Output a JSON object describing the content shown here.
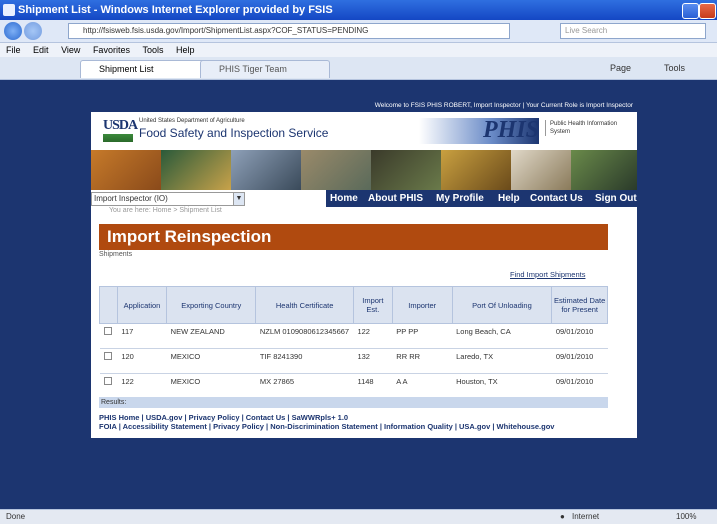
{
  "window": {
    "title": "Shipment List - Windows Internet Explorer provided by FSIS"
  },
  "address": {
    "url": "http://fsisweb.fsis.usda.gov/Import/ShipmentList.aspx?COF_STATUS=PENDING",
    "search_placeholder": "Live Search"
  },
  "menu": [
    "File",
    "Edit",
    "View",
    "Favorites",
    "Tools",
    "Help"
  ],
  "tabs": [
    {
      "label": "Shipment List"
    },
    {
      "label": "PHIS Tiger Team"
    }
  ],
  "toolbar": {
    "page_label": "Page",
    "tools_label": "Tools"
  },
  "site": {
    "welcome": "Welcome to FSIS PHIS ROBERT, Import Inspector | Your Current Role is Import Inspector",
    "agency_dept": "United States Department of Agriculture",
    "agency_name": "Food Safety and Inspection Service",
    "usda": "USDA",
    "phis": "PHIS",
    "phis_full": "Public Health Information System",
    "role_select": "Import Inspector (IO)",
    "nav": [
      "Home",
      "About PHIS",
      "My Profile",
      "Help",
      "Contact Us",
      "Sign Out"
    ],
    "breadcrumb": "You are here: Home > Shipment List"
  },
  "content": {
    "title": "Import Reinspection",
    "subtitle": "Shipments",
    "find_link": "Find Import Shipments",
    "columns": [
      "Application",
      "Exporting Country",
      "Health Certificate",
      "Import Est.",
      "Importer",
      "Port Of Unloading",
      "Estimated Date for Present"
    ],
    "rows": [
      {
        "application": "117",
        "country": "NEW ZEALAND",
        "certificate": "NZLM 0109080612345667",
        "est": "122",
        "importer": "PP PP",
        "port": "Long Beach, CA",
        "date": "09/01/2010"
      },
      {
        "application": "120",
        "country": "MEXICO",
        "certificate": "TIF 8241390",
        "est": "132",
        "importer": "RR RR",
        "port": "Laredo, TX",
        "date": "09/01/2010"
      },
      {
        "application": "122",
        "country": "MEXICO",
        "certificate": "MX 27865",
        "est": "1148",
        "importer": "A A",
        "port": "Houston, TX",
        "date": "09/01/2010"
      }
    ],
    "results": "Results:"
  },
  "footer": {
    "line1": "PHIS Home | USDA.gov | Privacy Policy | Contact Us | SaWWRpls+ 1.0",
    "line2": "FOIA | Accessibility Statement | Privacy Policy | Non-Discrimination Statement | Information Quality | USA.gov | Whitehouse.gov"
  },
  "status": {
    "left": "Done",
    "zone": "Internet",
    "zoom": "100%"
  },
  "colors": {
    "navy": "#1c3570",
    "banner": "#b04a0f",
    "grid_header": "#dbe3f0"
  }
}
